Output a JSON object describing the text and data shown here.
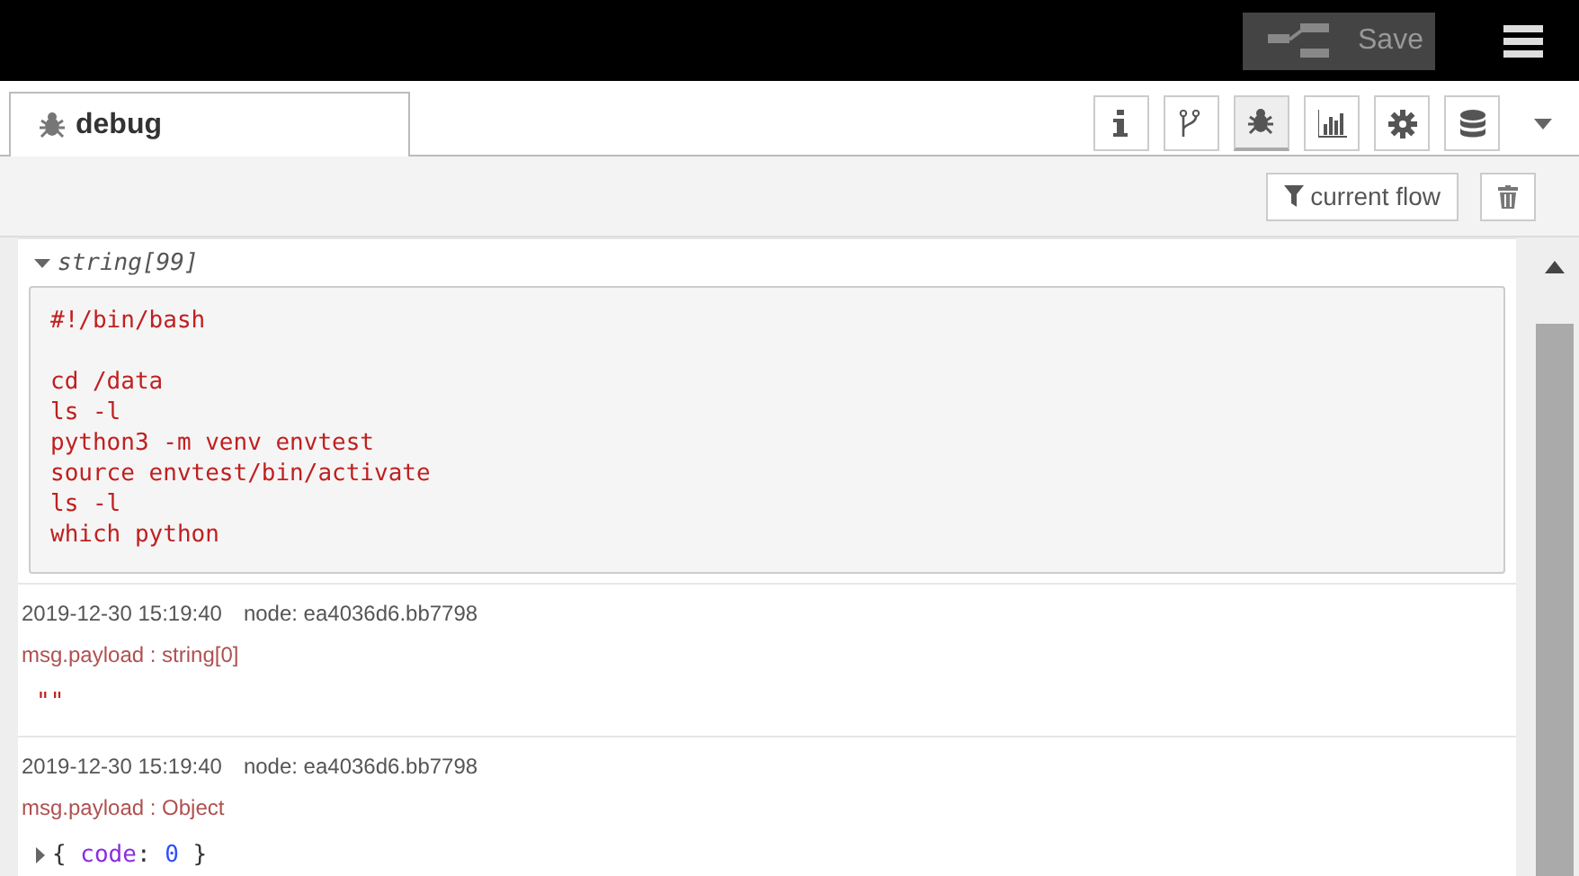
{
  "header": {
    "save_button": {
      "label": "Save",
      "disabled": true
    }
  },
  "tabs": [
    {
      "label": "debug",
      "selected": true
    }
  ],
  "sidebar_buttons": [
    {
      "kind": "info",
      "selected": false
    },
    {
      "kind": "branch",
      "selected": false
    },
    {
      "kind": "bug",
      "selected": true
    },
    {
      "kind": "chart",
      "selected": false
    },
    {
      "kind": "gear",
      "selected": false
    },
    {
      "kind": "database",
      "selected": false
    }
  ],
  "toolbar": {
    "filter_button": "current flow"
  },
  "messages": [
    {
      "kind": "string-block",
      "type_label": "string[99]",
      "expanded": true,
      "text": "#!/bin/bash\n\ncd /data\nls -l\npython3 -m venv envtest\nsource envtest/bin/activate\nls -l\nwhich python"
    },
    {
      "kind": "entry",
      "timestamp": "2019-12-30 15:19:40",
      "node": "node: ea4036d6.bb7798",
      "label": "msg.payload : string[0]",
      "value": {
        "kind": "string",
        "text": "\"\""
      }
    },
    {
      "kind": "entry",
      "timestamp": "2019-12-30 15:19:40",
      "node": "node: ea4036d6.bb7798",
      "label": "msg.payload : Object",
      "value": {
        "kind": "object",
        "expanded": false,
        "open": "{",
        "close": "}",
        "separator": ":",
        "fields": [
          {
            "key": "code",
            "value": "0"
          }
        ]
      }
    }
  ]
}
